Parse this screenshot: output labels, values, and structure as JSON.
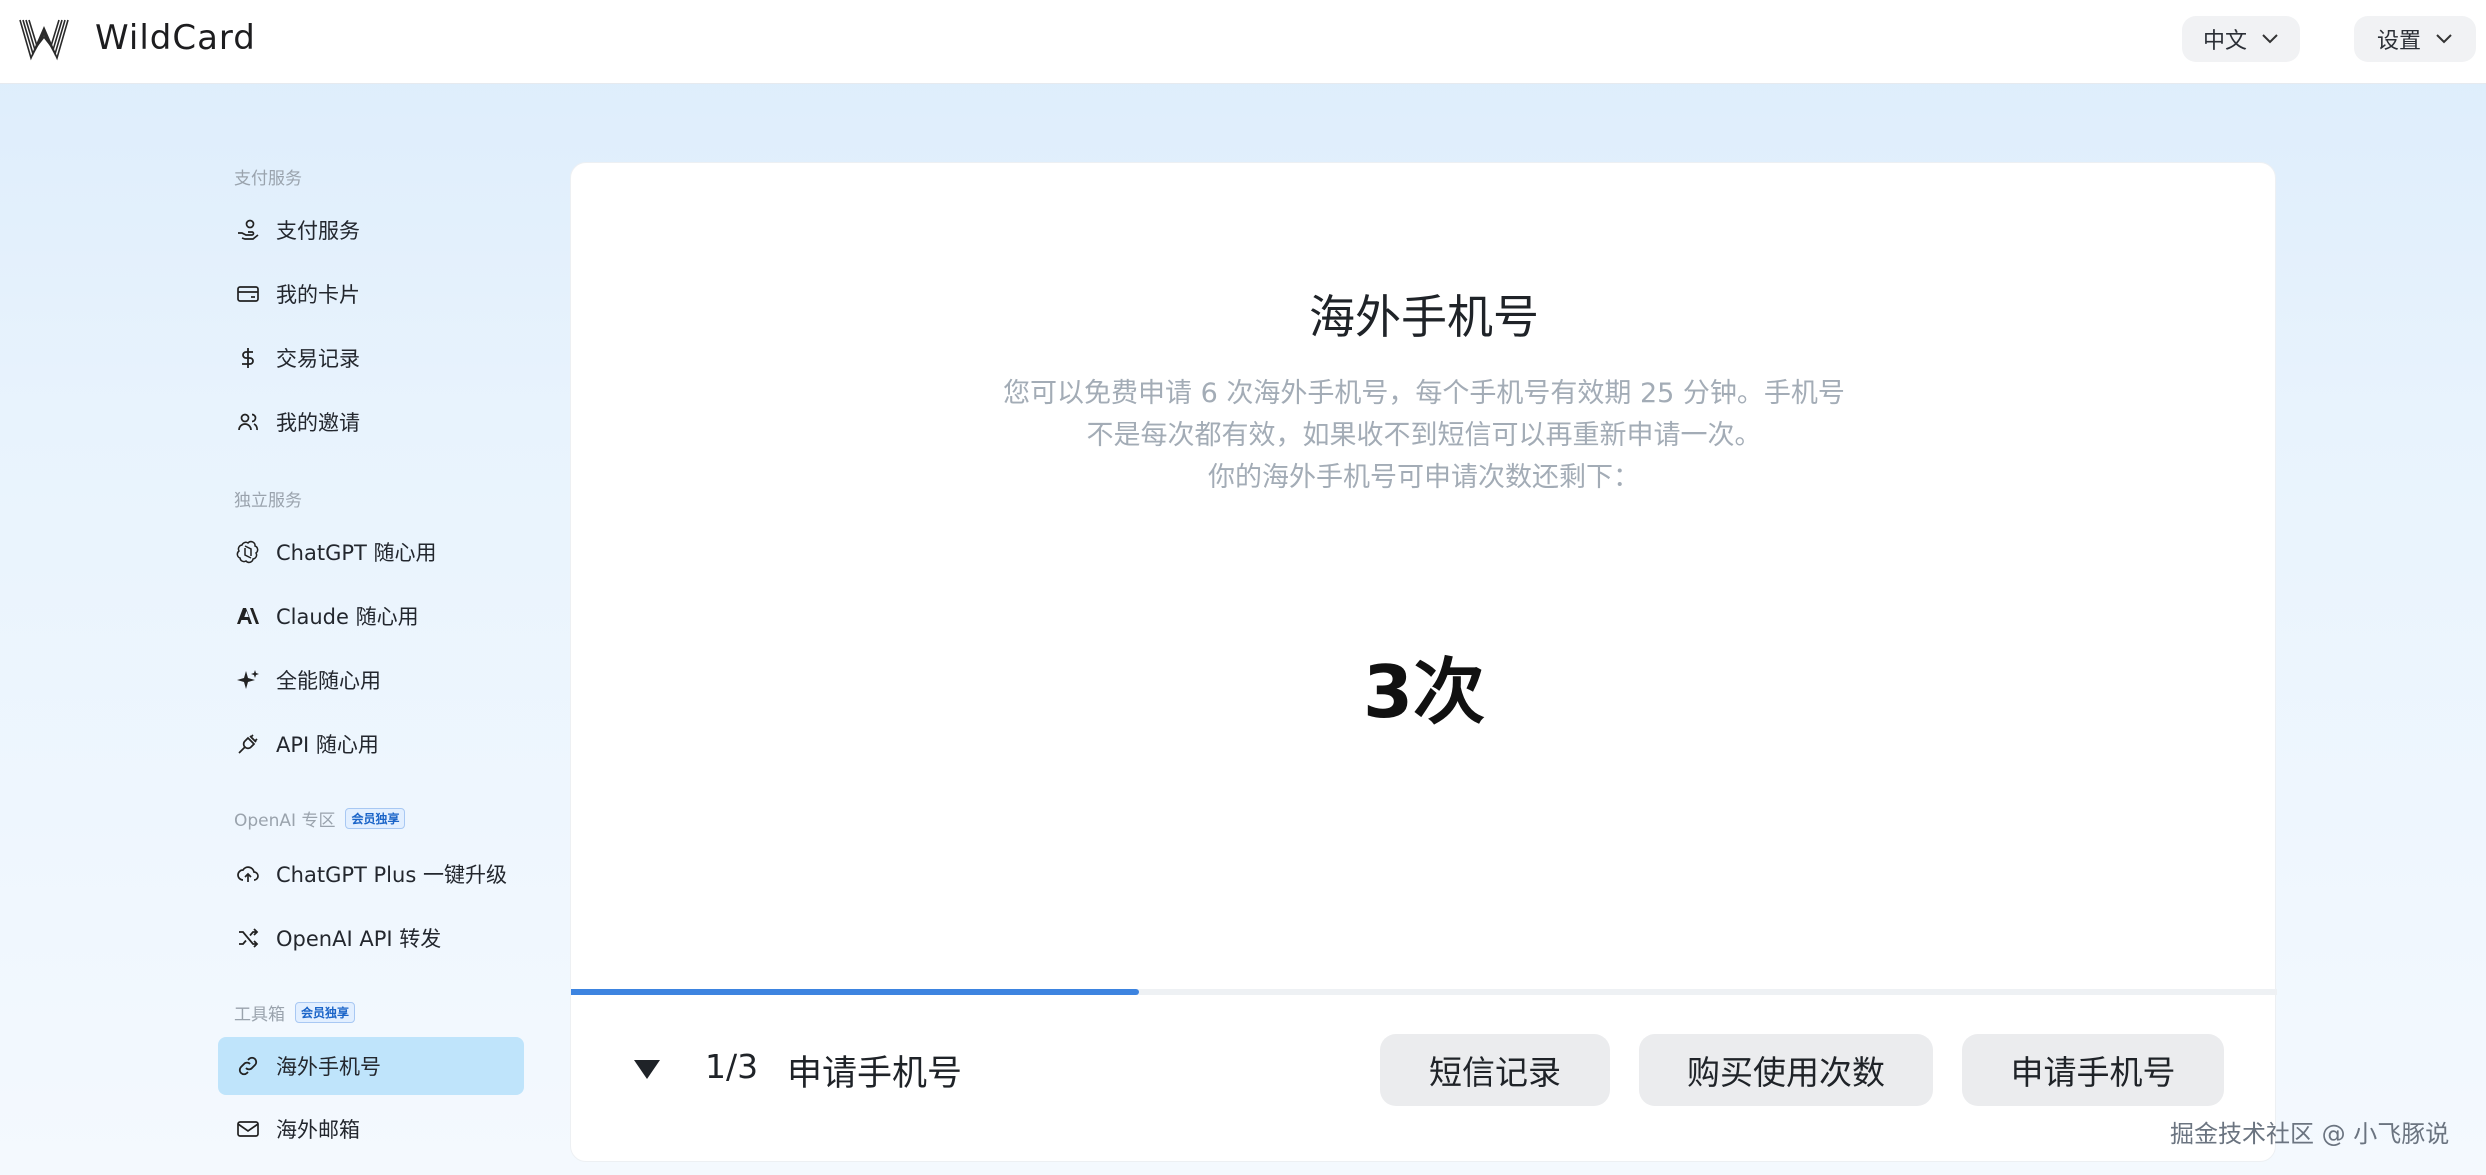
{
  "header": {
    "app_name": "WildCard",
    "language_label": "中文",
    "settings_label": "设置"
  },
  "sidebar": {
    "sections": [
      {
        "label": "支付服务",
        "badge": ""
      },
      {
        "label": "独立服务",
        "badge": ""
      },
      {
        "label": "OpenAI 专区",
        "badge": "会员独享"
      },
      {
        "label": "工具箱",
        "badge": "会员独享"
      }
    ],
    "items": [
      {
        "label": "支付服务",
        "icon": "hand-coin-icon"
      },
      {
        "label": "我的卡片",
        "icon": "card-icon"
      },
      {
        "label": "交易记录",
        "icon": "dollar-icon"
      },
      {
        "label": "我的邀请",
        "icon": "users-icon"
      },
      {
        "label": "ChatGPT 随心用",
        "icon": "openai-icon"
      },
      {
        "label": "Claude 随心用",
        "icon": "anthropic-icon"
      },
      {
        "label": "全能随心用",
        "icon": "sparkle-icon"
      },
      {
        "label": "API 随心用",
        "icon": "plug-icon"
      },
      {
        "label": "ChatGPT Plus 一键升级",
        "icon": "cloud-upload-icon"
      },
      {
        "label": "OpenAI API 转发",
        "icon": "shuffle-icon"
      },
      {
        "label": "海外手机号",
        "icon": "link-icon",
        "active": true
      },
      {
        "label": "海外邮箱",
        "icon": "mail-icon"
      }
    ]
  },
  "main": {
    "title": "海外手机号",
    "description_lines": [
      "您可以免费申请 6 次海外手机号，每个手机号有效期 25 分钟。手机号",
      "不是每次都有效，如果收不到短信可以再重新申请一次。",
      "你的海外手机号可申请次数还剩下："
    ],
    "remaining": "3次",
    "progress": 0.333,
    "step_count": "1/3",
    "step_label": "申请手机号",
    "buttons": {
      "sms_records": "短信记录",
      "buy_uses": "购买使用次数",
      "apply_number": "申请手机号"
    }
  },
  "watermark": "掘金技术社区 @ 小飞豚说",
  "colors": {
    "accent": "#3d84e0",
    "active_item_bg": "#bfe4fb",
    "badge_text": "#1a64c8"
  }
}
